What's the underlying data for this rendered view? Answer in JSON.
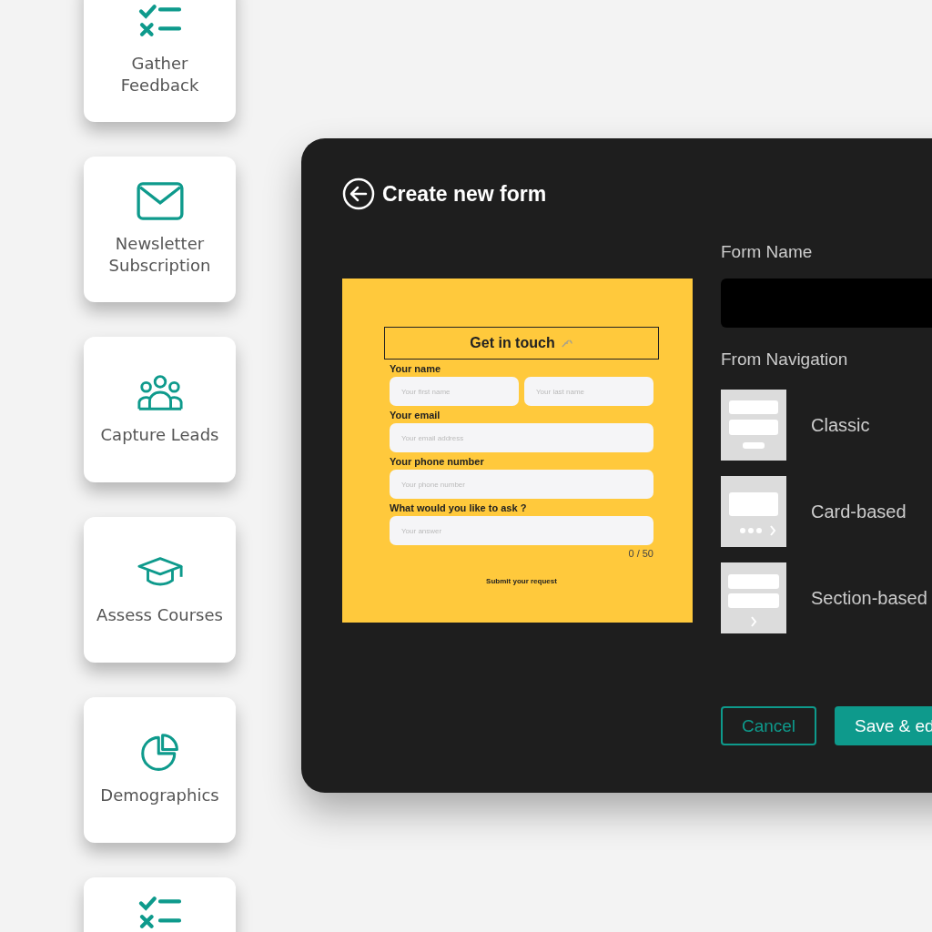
{
  "templates": [
    {
      "kind": "checklist",
      "label": "Gather Feedback"
    },
    {
      "kind": "mail",
      "label": "Newsletter Subscription"
    },
    {
      "kind": "people",
      "label": "Capture Leads"
    },
    {
      "kind": "cap",
      "label": "Assess Courses"
    },
    {
      "kind": "pie",
      "label": "Demographics"
    },
    {
      "kind": "checklist"
    }
  ],
  "dialog": {
    "title": "Create new form",
    "preview": {
      "heading": "Get in touch",
      "fields": [
        {
          "label": "Your name",
          "placeholders": [
            "Your first name",
            "Your last name"
          ]
        },
        {
          "label": "Your email",
          "placeholders": [
            "Your email address"
          ]
        },
        {
          "label": "Your phone number",
          "placeholders": [
            "Your phone number"
          ]
        },
        {
          "label": "What would you like to ask ?",
          "placeholders": [
            "Your answer"
          ],
          "counter": "0 / 50"
        }
      ],
      "submit": "Submit your request"
    },
    "form_name": {
      "label": "Form Name"
    },
    "navigation": {
      "label": "From Navigation",
      "options": [
        {
          "kind": "classic",
          "label": "Classic"
        },
        {
          "kind": "card",
          "label": "Card-based"
        },
        {
          "kind": "section",
          "label": "Section-based"
        }
      ]
    },
    "buttons": {
      "cancel": "Cancel",
      "save": "Save & ed"
    }
  }
}
